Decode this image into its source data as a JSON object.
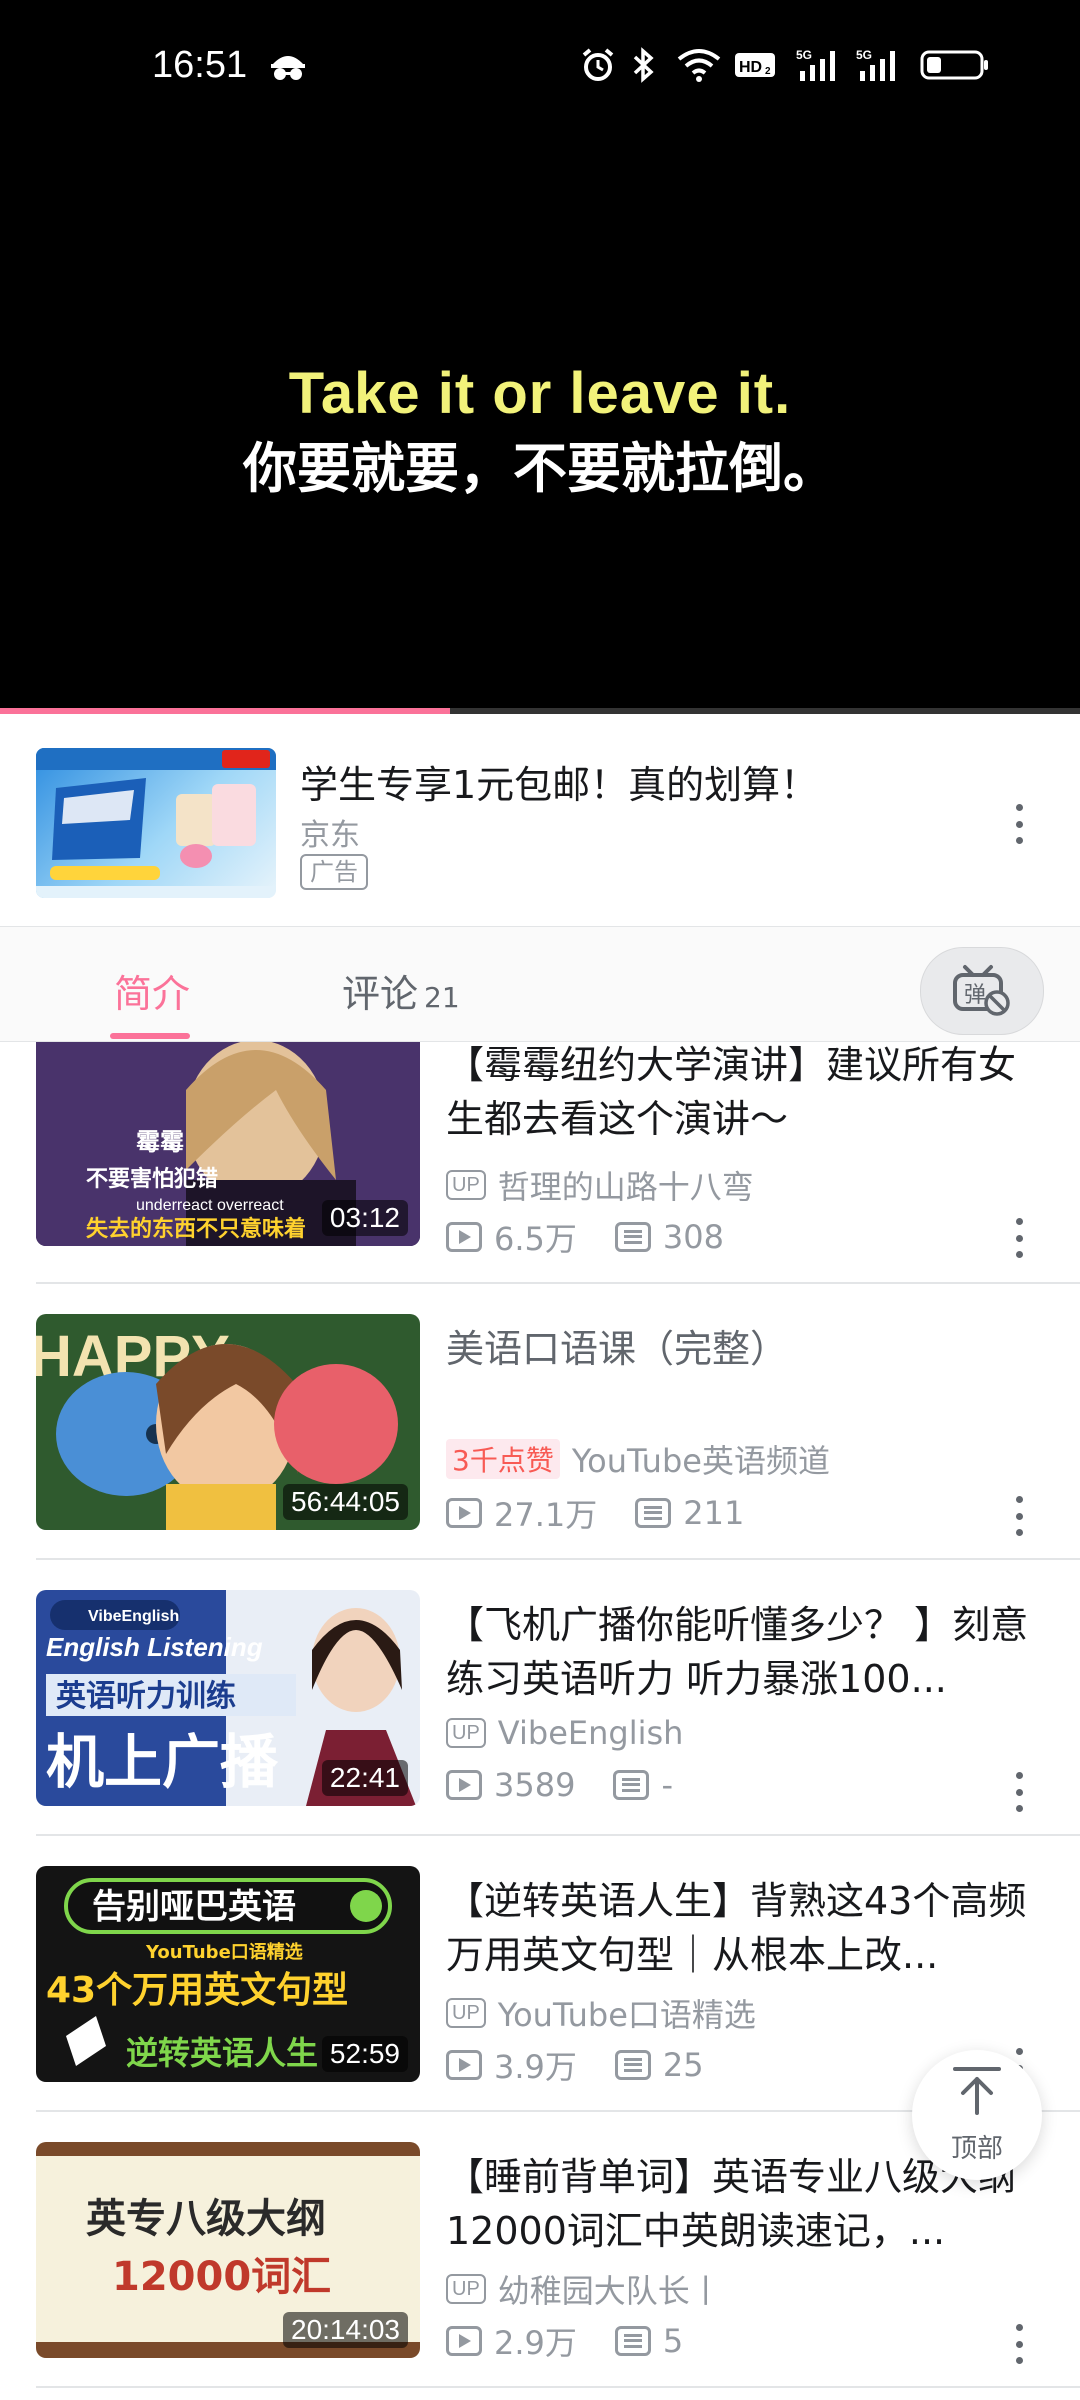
{
  "status_bar": {
    "time": "16:51",
    "icons": [
      "incognito-icon",
      "alarm-icon",
      "bluetooth-icon",
      "wifi-icon",
      "hd-icon",
      "signal-5g-icon",
      "signal-5g-icon",
      "battery-icon"
    ],
    "hd_label": "HD2",
    "network_label": "5G"
  },
  "video": {
    "subtitle_en": "Take it or leave it.",
    "subtitle_zh": "你要就要，不要就拉倒。",
    "progress": 0.417
  },
  "ad": {
    "title": "学生专享1元包邮！真的划算！",
    "source": "京东",
    "badge": "广告"
  },
  "tabs": {
    "intro": "简介",
    "comments": "评论",
    "comments_count": "21",
    "danmaku_icon_label": "弹"
  },
  "related": [
    {
      "title": "【霉霉纽约大学演讲】建议所有女生都去看这个演讲～",
      "uploader": "哲理的山路十八弯",
      "views": "6.5万",
      "comments": "308",
      "duration": "03:12",
      "thumb_text": [
        "霉霉",
        "不要害怕犯错",
        "underreact overreact",
        "失去的东西不只意味着"
      ]
    },
    {
      "title": "美语口语课（完整）",
      "like_badge": "3千点赞",
      "uploader": "YouTube英语频道",
      "views": "27.1万",
      "comments": "211",
      "duration": "56:44:05",
      "thumb_text": [
        "HAPPY"
      ]
    },
    {
      "title": "【飞机广播你能听懂多少？ 】刻意练习英语听力 听力暴涨100...",
      "uploader": "VibeEnglish",
      "views": "3589",
      "comments": "-",
      "duration": "22:41",
      "thumb_text": [
        "VibeEnglish",
        "English Listening",
        "英语听力训练",
        "机上广播"
      ]
    },
    {
      "title": "【逆转英语人生】背熟这43个高频万用英文句型｜从根本上改...",
      "uploader": "YouTube口语精选",
      "views": "3.9万",
      "comments": "25",
      "duration": "52:59",
      "thumb_text": [
        "告别哑巴英语",
        "YouTube口语精选",
        "43个万用英文句型",
        "逆转英语人生"
      ]
    },
    {
      "title": "【睡前背单词】英语专业八级大纲12000词汇中英朗读速记，...",
      "uploader": "幼稚园大队长丨",
      "views": "2.9万",
      "comments": "5",
      "duration": "20:14:03",
      "thumb_text": [
        "英专八级大纲",
        "12000词汇"
      ]
    }
  ],
  "back_to_top": "顶部",
  "up_label": "UP",
  "colors": {
    "accent": "#fb7299",
    "muted": "#9499a0",
    "text": "#18191c"
  }
}
